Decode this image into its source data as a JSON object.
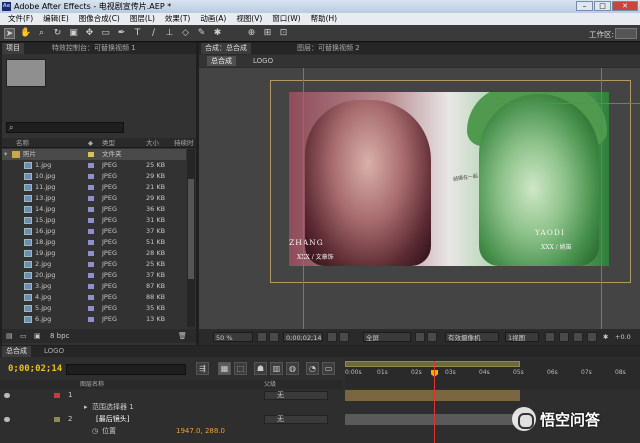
{
  "window": {
    "title": "Adobe After Effects - 电视剧宣传片.AEP *",
    "app_icon": "Ae"
  },
  "menu": [
    "文件(F)",
    "编辑(E)",
    "图像合成(C)",
    "图层(L)",
    "效果(T)",
    "动画(A)",
    "视图(V)",
    "窗口(W)",
    "帮助(H)"
  ],
  "toolbar": {
    "workspace_label": "工作区:"
  },
  "project": {
    "tabs": [
      "项目",
      "特效控制台：可替换视频 1"
    ],
    "columns": {
      "name": "名称",
      "type": "类型",
      "size": "大小",
      "duration": "持续时间"
    },
    "items": [
      {
        "name": "照片",
        "type": "文件夹",
        "size": "",
        "kind": "folder"
      },
      {
        "name": "1.jpg",
        "type": "JPEG",
        "size": "25 KB",
        "kind": "img"
      },
      {
        "name": "10.jpg",
        "type": "JPEG",
        "size": "29 KB",
        "kind": "img"
      },
      {
        "name": "11.jpg",
        "type": "JPEG",
        "size": "21 KB",
        "kind": "img"
      },
      {
        "name": "13.jpg",
        "type": "JPEG",
        "size": "29 KB",
        "kind": "img"
      },
      {
        "name": "14.jpg",
        "type": "JPEG",
        "size": "36 KB",
        "kind": "img"
      },
      {
        "name": "15.jpg",
        "type": "JPEG",
        "size": "31 KB",
        "kind": "img"
      },
      {
        "name": "16.jpg",
        "type": "JPEG",
        "size": "37 KB",
        "kind": "img"
      },
      {
        "name": "18.jpg",
        "type": "JPEG",
        "size": "51 KB",
        "kind": "img"
      },
      {
        "name": "19.jpg",
        "type": "JPEG",
        "size": "28 KB",
        "kind": "img"
      },
      {
        "name": "2.jpg",
        "type": "JPEG",
        "size": "25 KB",
        "kind": "img"
      },
      {
        "name": "20.jpg",
        "type": "JPEG",
        "size": "37 KB",
        "kind": "img"
      },
      {
        "name": "3.jpg",
        "type": "JPEG",
        "size": "87 KB",
        "kind": "img"
      },
      {
        "name": "4.jpg",
        "type": "JPEG",
        "size": "88 KB",
        "kind": "img"
      },
      {
        "name": "5.jpg",
        "type": "JPEG",
        "size": "35 KB",
        "kind": "img"
      },
      {
        "name": "6.jpg",
        "type": "JPEG",
        "size": "13 KB",
        "kind": "img"
      }
    ],
    "bpc": "8 bpc"
  },
  "composition": {
    "tabs": [
      "合成：总合成",
      "图层：可替换视频 2"
    ],
    "breadcrumbs": [
      "总合成",
      "LOGO"
    ],
    "overlay": {
      "left_name": "ZHANG",
      "left_sub": "XXX / 文章饰",
      "right_name": "YAODI",
      "right_sub": "XXX / 姚笛",
      "center_small": "结婚在一起"
    },
    "footer": {
      "zoom": "50 %",
      "timecode": "0;00;02;14",
      "resolution": "全屏",
      "camera": "有效摄像机",
      "views": "1视图",
      "offset": "+0.0"
    }
  },
  "timeline": {
    "tabs": [
      "总合成",
      "LOGO"
    ],
    "timecode": "0;00;02;14",
    "columns": {
      "layer_name": "图层名称",
      "parent": "父级"
    },
    "ruler_ticks": [
      "0:00s",
      "01s",
      "02s",
      "03s",
      "04s",
      "05s",
      "06s",
      "07s",
      "08s"
    ],
    "layers": [
      {
        "num": "1",
        "name": "",
        "parent": "无"
      },
      {
        "num": "",
        "name": "范围选择器 1",
        "parent": ""
      },
      {
        "num": "2",
        "name": "[最后镜头]",
        "parent": "无"
      },
      {
        "num": "",
        "name": "位置",
        "value": "1947.0, 288.0",
        "parent": ""
      }
    ]
  },
  "watermark": {
    "text": "悟空问答"
  }
}
